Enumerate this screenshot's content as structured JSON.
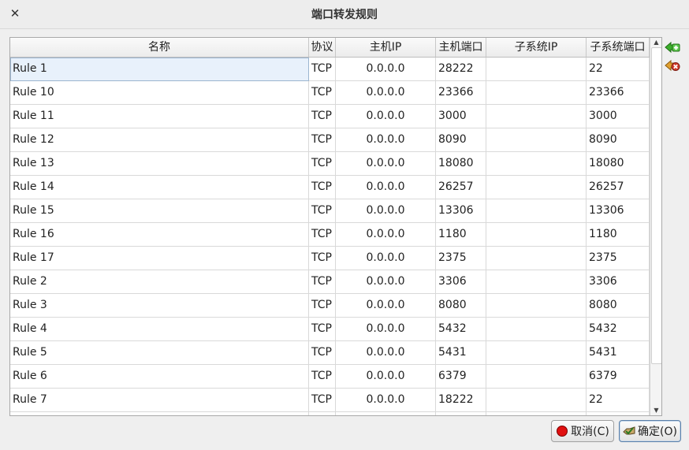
{
  "window": {
    "title": "端口转发规则",
    "close_glyph": "✕"
  },
  "table": {
    "columns": [
      "名称",
      "协议",
      "主机IP",
      "主机端口",
      "子系统IP",
      "子系统端口"
    ],
    "rows": [
      [
        "Rule 1",
        "TCP",
        "0.0.0.0",
        "28222",
        "",
        "22"
      ],
      [
        "Rule 10",
        "TCP",
        "0.0.0.0",
        "23366",
        "",
        "23366"
      ],
      [
        "Rule 11",
        "TCP",
        "0.0.0.0",
        "3000",
        "",
        "3000"
      ],
      [
        "Rule 12",
        "TCP",
        "0.0.0.0",
        "8090",
        "",
        "8090"
      ],
      [
        "Rule 13",
        "TCP",
        "0.0.0.0",
        "18080",
        "",
        "18080"
      ],
      [
        "Rule 14",
        "TCP",
        "0.0.0.0",
        "26257",
        "",
        "26257"
      ],
      [
        "Rule 15",
        "TCP",
        "0.0.0.0",
        "13306",
        "",
        "13306"
      ],
      [
        "Rule 16",
        "TCP",
        "0.0.0.0",
        "1180",
        "",
        "1180"
      ],
      [
        "Rule 17",
        "TCP",
        "0.0.0.0",
        "2375",
        "",
        "2375"
      ],
      [
        "Rule 2",
        "TCP",
        "0.0.0.0",
        "3306",
        "",
        "3306"
      ],
      [
        "Rule 3",
        "TCP",
        "0.0.0.0",
        "8080",
        "",
        "8080"
      ],
      [
        "Rule 4",
        "TCP",
        "0.0.0.0",
        "5432",
        "",
        "5432"
      ],
      [
        "Rule 5",
        "TCP",
        "0.0.0.0",
        "5431",
        "",
        "5431"
      ],
      [
        "Rule 6",
        "TCP",
        "0.0.0.0",
        "6379",
        "",
        "6379"
      ],
      [
        "Rule 7",
        "TCP",
        "0.0.0.0",
        "18222",
        "",
        "22"
      ],
      [
        "",
        "",
        "",
        "",
        "",
        ""
      ]
    ],
    "selected_row": 0
  },
  "side_buttons": {
    "add_icon": "add-rule-icon",
    "remove_icon": "remove-rule-icon"
  },
  "footer": {
    "cancel_label": "取消(C)",
    "ok_label": "确定(O)"
  },
  "colors": {
    "selection": "#e8f1fb",
    "add_green": "#3cae2c",
    "remove_red": "#d23a2a",
    "cancel_red": "#e01010"
  }
}
